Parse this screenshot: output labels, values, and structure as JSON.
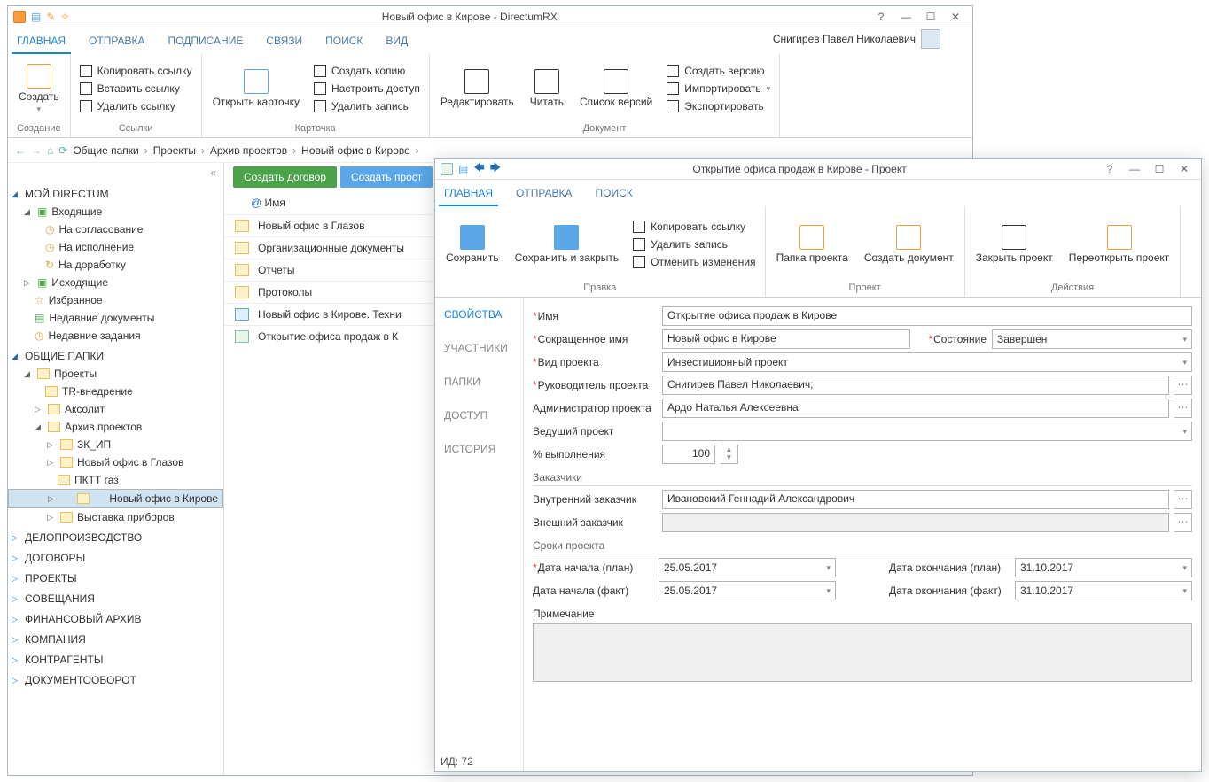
{
  "main_window": {
    "title": "Новый офис в Кирове - DirectumRX",
    "user": "Снигирев Павел Николаевич",
    "tabs": [
      "ГЛАВНАЯ",
      "ОТПРАВКА",
      "ПОДПИСАНИЕ",
      "СВЯЗИ",
      "ПОИСК",
      "ВИД"
    ],
    "ribbon": {
      "create": {
        "btn": "Создать",
        "group": "Создание"
      },
      "links": {
        "copy": "Копировать ссылку",
        "paste": "Вставить ссылку",
        "del": "Удалить ссылку",
        "group": "Ссылки"
      },
      "card": {
        "open": "Открыть карточку",
        "copy": "Создать копию",
        "access": "Настроить доступ",
        "delrec": "Удалить запись",
        "group": "Карточка"
      },
      "doc": {
        "edit": "Редактировать",
        "read": "Читать",
        "versions": "Список версий",
        "createver": "Создать версию",
        "import": "Импортировать",
        "export": "Экспортировать",
        "group": "Документ"
      }
    },
    "breadcrumb": [
      "Общие папки",
      "Проекты",
      "Архив проектов",
      "Новый офис в Кирове"
    ],
    "side": {
      "mydir": "МОЙ DIRECTUM",
      "inbox": "Входящие",
      "inbox_items": [
        "На согласование",
        "На исполнение",
        "На доработку"
      ],
      "outbox": "Исходящие",
      "fav": "Избранное",
      "recdoc": "Недавние документы",
      "rectask": "Недавние задания",
      "shared": "ОБЩИЕ ПАПКИ",
      "projects": "Проекты",
      "proj_items": [
        "TR-внедрение",
        "Аксолит",
        "Архив проектов"
      ],
      "archive_items": [
        "ЗК_ИП",
        "Новый офис в Глазов",
        "ПКТТ газ",
        "Новый офис в Кирове",
        "Выставка приборов"
      ],
      "sections": [
        "ДЕЛОПРОИЗВОДСТВО",
        "ДОГОВОРЫ",
        "ПРОЕКТЫ",
        "СОВЕЩАНИЯ",
        "ФИНАНСОВЫЙ АРХИВ",
        "КОМПАНИЯ",
        "КОНТРАГЕНТЫ",
        "ДОКУМЕНТООБОРОТ"
      ]
    },
    "list": {
      "btn_contract": "Создать договор",
      "btn_simple": "Создать прост",
      "col": "Имя",
      "rows": [
        "Новый офис в Глазов",
        "Организационные документы",
        "Отчеты",
        "Протоколы",
        "Новый офис в Кирове. Техни",
        "Открытие офиса продаж в К"
      ]
    }
  },
  "dialog": {
    "title": "Открытие офиса продаж в Кирове - Проект",
    "tabs": [
      "ГЛАВНАЯ",
      "ОТПРАВКА",
      "ПОИСК"
    ],
    "ribbon": {
      "save": "Сохранить",
      "saveclose": "Сохранить и закрыть",
      "copy": "Копировать ссылку",
      "delrec": "Удалить запись",
      "undo": "Отменить изменения",
      "grp_edit": "Правка",
      "folder": "Папка проекта",
      "createdoc": "Создать документ",
      "grp_proj": "Проект",
      "close": "Закрыть проект",
      "reopen": "Переоткрыть проект",
      "grp_actions": "Действия"
    },
    "vtabs": [
      "СВОЙСТВА",
      "УЧАСТНИКИ",
      "ПАПКИ",
      "ДОСТУП",
      "ИСТОРИЯ"
    ],
    "form": {
      "name_lbl": "Имя",
      "name_val": "Открытие офиса продаж в Кирове",
      "short_lbl": "Сокращенное имя",
      "short_val": "Новый офис в Кирове",
      "state_lbl": "Состояние",
      "state_val": "Завершен",
      "kind_lbl": "Вид проекта",
      "kind_val": "Инвестиционный проект",
      "lead_lbl": "Руководитель проекта",
      "lead_val": "Снигирев Павел Николаевич;",
      "admin_lbl": "Администратор проекта",
      "admin_val": "Ардо Наталья Алексеевна",
      "parent_lbl": "Ведущий проект",
      "parent_val": "",
      "pct_lbl": "% выполнения",
      "pct_val": "100",
      "sec_customers": "Заказчики",
      "intc_lbl": "Внутренний заказчик",
      "intc_val": "Ивановский Геннадий Александрович",
      "extc_lbl": "Внешний заказчик",
      "extc_val": "",
      "sec_dates": "Сроки проекта",
      "dstart_p_lbl": "Дата начала (план)",
      "dstart_p_val": "25.05.2017",
      "dend_p_lbl": "Дата окончания (план)",
      "dend_p_val": "31.10.2017",
      "dstart_f_lbl": "Дата начала (факт)",
      "dstart_f_val": "25.05.2017",
      "dend_f_lbl": "Дата окончания (факт)",
      "dend_f_val": "31.10.2017",
      "note_lbl": "Примечание"
    },
    "status": "ИД: 72"
  }
}
